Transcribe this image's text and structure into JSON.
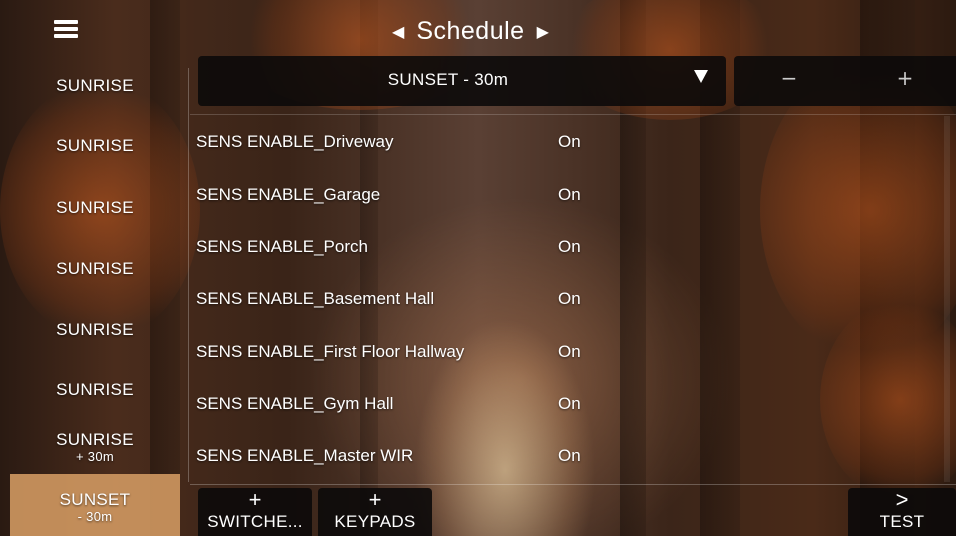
{
  "header": {
    "title": "Schedule",
    "prev_arrow": "◀",
    "next_arrow": "▶"
  },
  "sidebar": {
    "items": [
      {
        "label": "SUNRISE",
        "sub": ""
      },
      {
        "label": "SUNRISE",
        "sub": ""
      },
      {
        "label": "SUNRISE",
        "sub": ""
      },
      {
        "label": "SUNRISE",
        "sub": ""
      },
      {
        "label": "SUNRISE",
        "sub": ""
      },
      {
        "label": "SUNRISE",
        "sub": ""
      },
      {
        "label": "SUNRISE",
        "sub": "+ 30m"
      },
      {
        "label": "SUNSET",
        "sub": "- 30m"
      }
    ],
    "active_color": "#cd965f"
  },
  "dropdown": {
    "value": "SUNSET - 30m"
  },
  "stepper": {
    "minus": "−",
    "plus": "+"
  },
  "list": {
    "rows": [
      {
        "name": "SENS ENABLE_Driveway",
        "state": "On"
      },
      {
        "name": "SENS ENABLE_Garage",
        "state": "On"
      },
      {
        "name": "SENS ENABLE_Porch",
        "state": "On"
      },
      {
        "name": "SENS ENABLE_Basement Hall",
        "state": "On"
      },
      {
        "name": "SENS ENABLE_First Floor Hallway",
        "state": "On"
      },
      {
        "name": "SENS ENABLE_Gym Hall",
        "state": "On"
      },
      {
        "name": "SENS ENABLE_Master WIR",
        "state": "On"
      }
    ]
  },
  "bottom": {
    "switches": {
      "symbol": "+",
      "label": "SWITCHE..."
    },
    "keypads": {
      "symbol": "+",
      "label": "KEYPADS"
    },
    "test": {
      "symbol": ">",
      "label": "TEST"
    }
  }
}
